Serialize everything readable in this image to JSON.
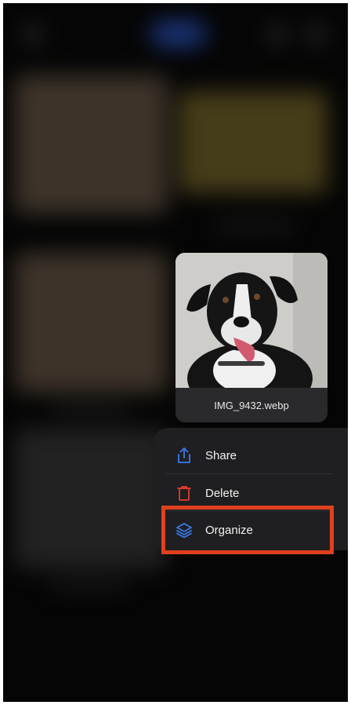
{
  "preview": {
    "filename": "IMG_9432.webp"
  },
  "menu": {
    "items": [
      {
        "label": "Share",
        "icon": "share-icon",
        "color": "#3a7bf0"
      },
      {
        "label": "Delete",
        "icon": "trash-icon",
        "color": "#e5392f"
      },
      {
        "label": "Organize",
        "icon": "layers-icon",
        "color": "#3a7bf0"
      }
    ],
    "highlight_color": "#e0401f"
  }
}
